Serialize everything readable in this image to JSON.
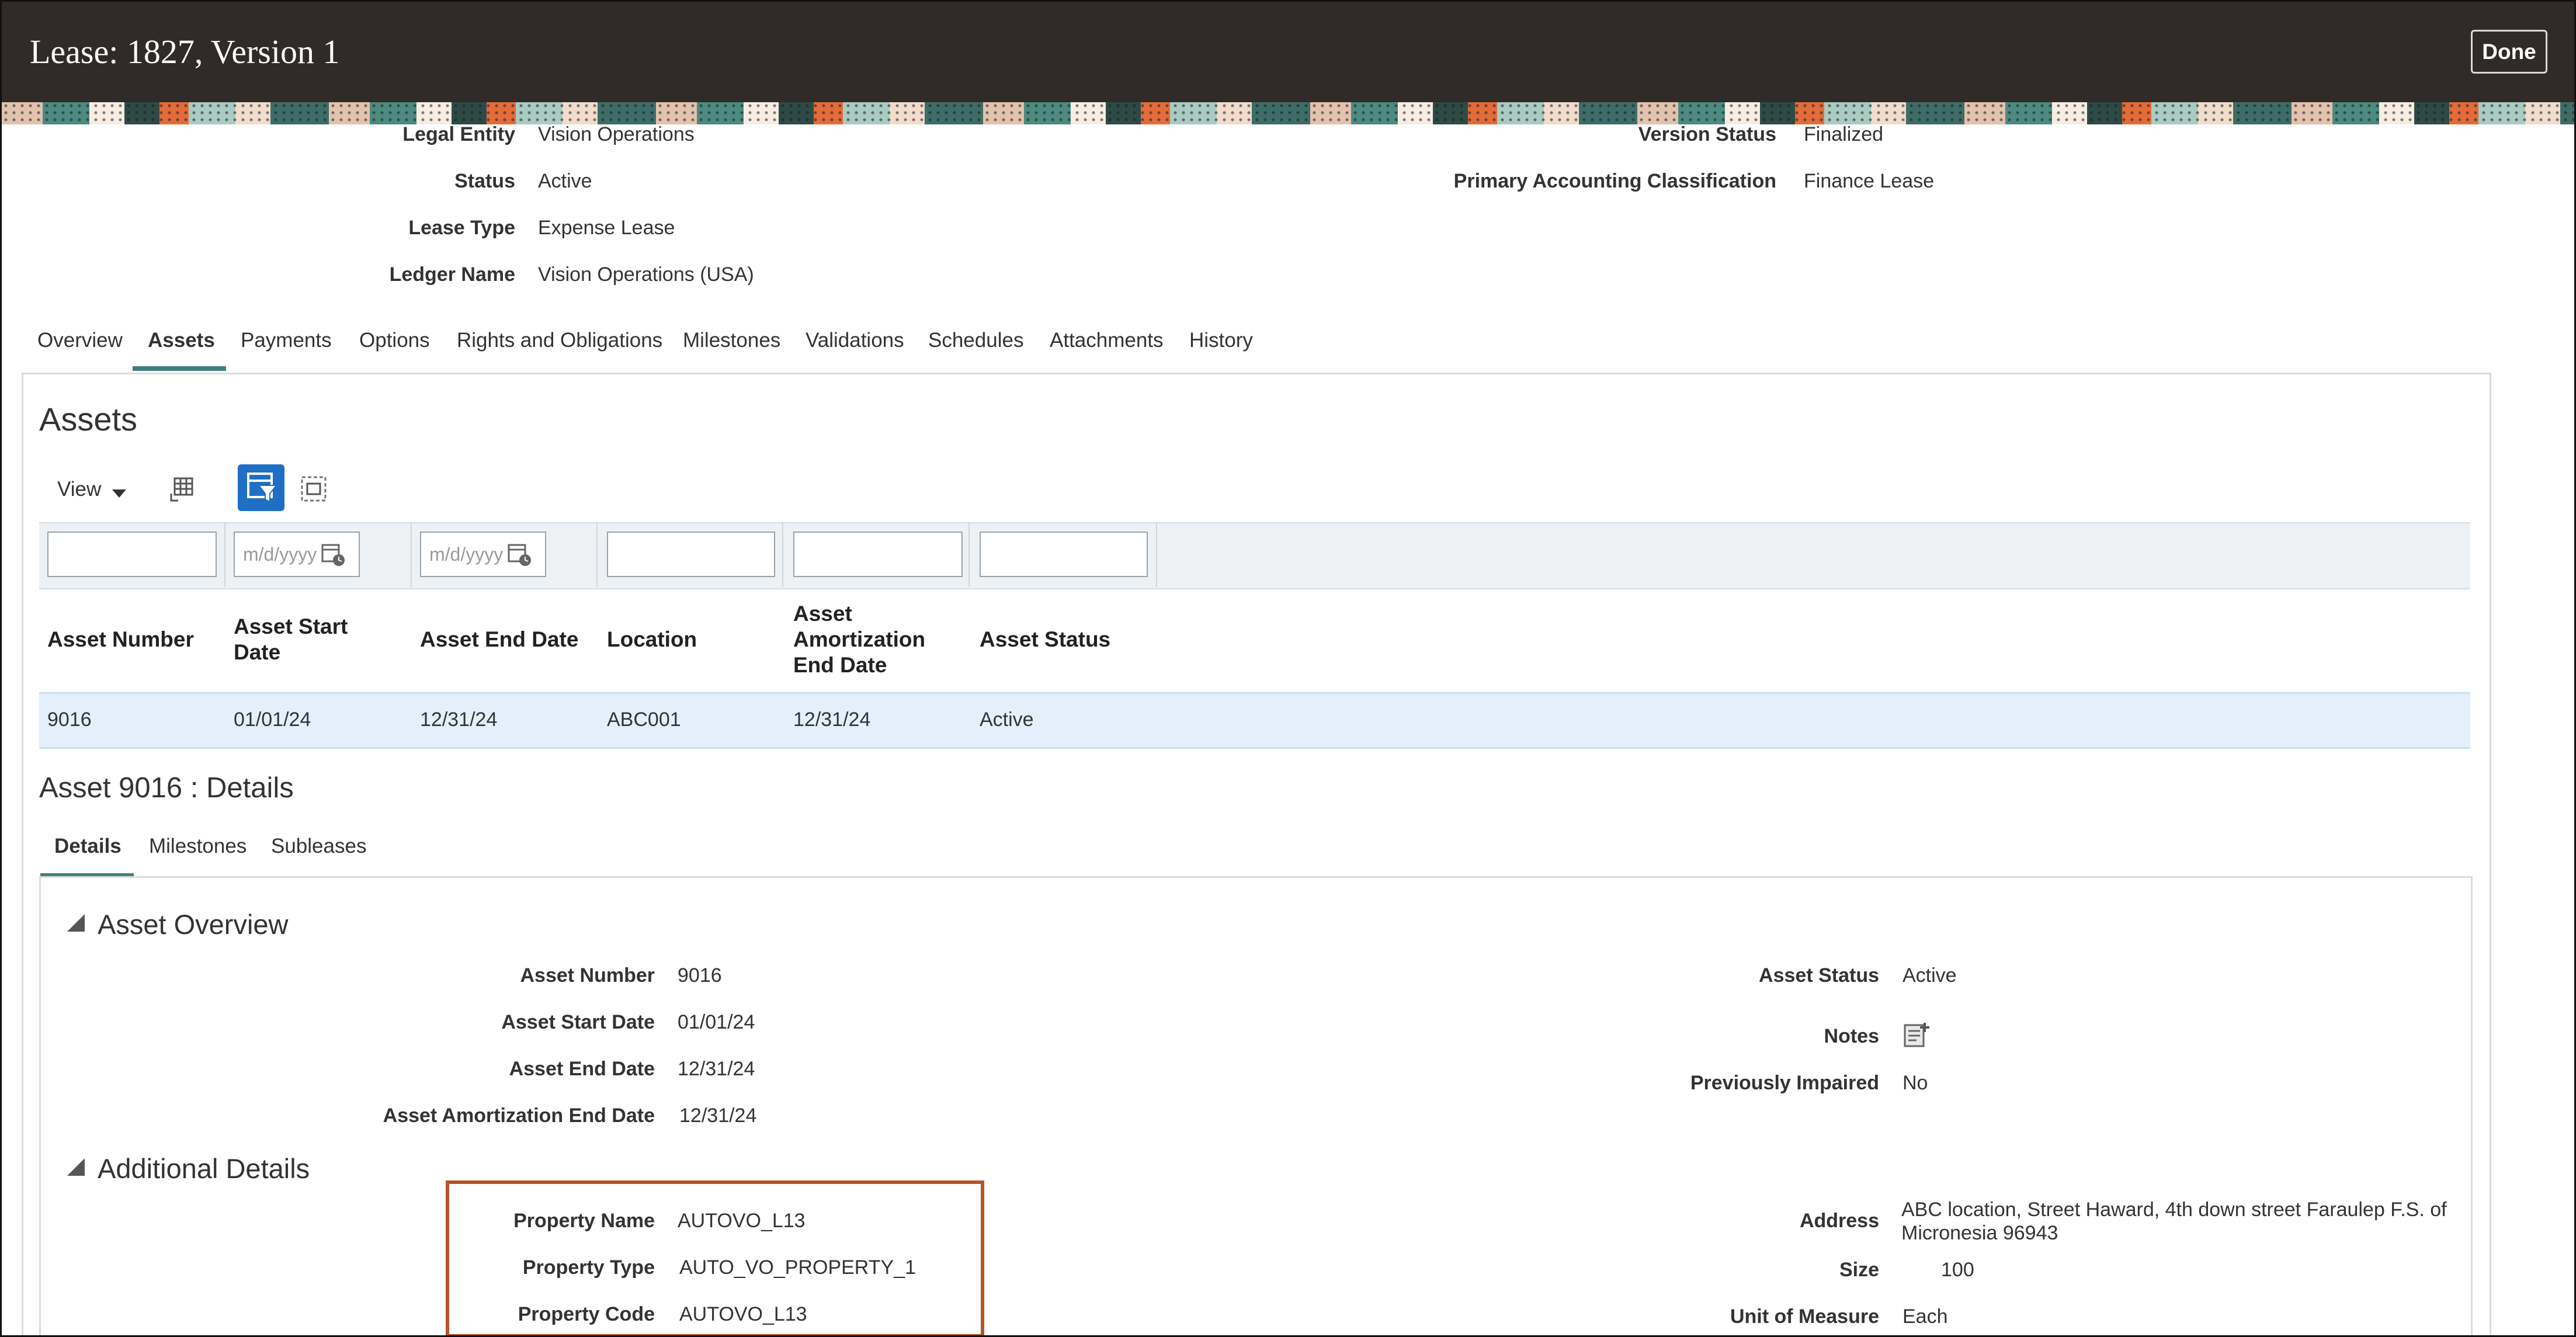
{
  "header": {
    "title": "Lease: 1827, Version 1",
    "done_label": "Done"
  },
  "lease_info": {
    "left": [
      {
        "label": "Legal Entity",
        "value": "Vision Operations"
      },
      {
        "label": "Status",
        "value": "Active"
      },
      {
        "label": "Lease Type",
        "value": "Expense Lease"
      },
      {
        "label": "Ledger Name",
        "value": "Vision Operations (USA)"
      }
    ],
    "right": [
      {
        "label": "Version Status",
        "value": "Finalized"
      },
      {
        "label": "Primary Accounting Classification",
        "value": "Finance Lease"
      }
    ]
  },
  "tabs": [
    "Overview",
    "Assets",
    "Payments",
    "Options",
    "Rights and Obligations",
    "Milestones",
    "Validations",
    "Schedules",
    "Attachments",
    "History"
  ],
  "selected_tab": "Assets",
  "assets": {
    "heading": "Assets",
    "view_label": "View",
    "date_placeholder": "m/d/yyyy",
    "columns": [
      "Asset Number",
      "Asset Start Date",
      "Asset End Date",
      "Location",
      "Asset Amortization End Date",
      "Asset Status"
    ],
    "rows": [
      {
        "asset_number": "9016",
        "start_date": "01/01/24",
        "end_date": "12/31/24",
        "location": "ABC001",
        "amortization_end_date": "12/31/24",
        "status": "Active"
      }
    ]
  },
  "details": {
    "heading": "Asset 9016 : Details",
    "subtabs": [
      "Details",
      "Milestones",
      "Subleases"
    ],
    "selected_subtab": "Details",
    "overview": {
      "heading": "Asset Overview",
      "left": [
        {
          "label": "Asset Number",
          "value": "9016"
        },
        {
          "label": "Asset Start Date",
          "value": "01/01/24"
        },
        {
          "label": "Asset End Date",
          "value": "12/31/24"
        },
        {
          "label": "Asset Amortization End Date",
          "value": "12/31/24"
        }
      ],
      "right": [
        {
          "label": "Asset Status",
          "value": "Active"
        },
        {
          "label": "Notes",
          "value": ""
        },
        {
          "label": "Previously Impaired",
          "value": "No"
        }
      ]
    },
    "additional": {
      "heading": "Additional Details",
      "left": [
        {
          "label": "Property Name",
          "value": "AUTOVO_L13"
        },
        {
          "label": "Property Type",
          "value": "AUTO_VO_PROPERTY_1"
        },
        {
          "label": "Property Code",
          "value": "AUTOVO_L13"
        }
      ],
      "right": [
        {
          "label": "Address",
          "value_line1": "ABC location, Street Haward, 4th down street Faraulep F.S. of",
          "value_line2": "Micronesia 96943"
        },
        {
          "label": "Size",
          "value": "100"
        },
        {
          "label": "Unit of Measure",
          "value": "Each"
        }
      ]
    }
  },
  "colors": {
    "header_bg": "#302b28",
    "tab_underline": "#3e7f7b",
    "row_selected": "#e3f0fb",
    "highlight_box": "#b5542a",
    "filter_button": "#1f6fc5"
  }
}
